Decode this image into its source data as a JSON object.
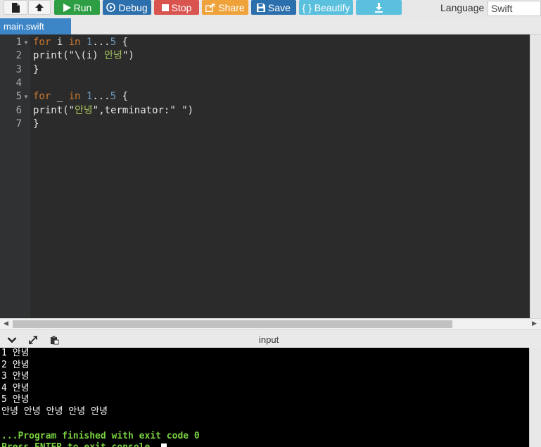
{
  "toolbar": {
    "new_file_icon": "file-icon",
    "upload_icon": "upload-icon",
    "run": {
      "label": "Run",
      "color": "#2e9e44"
    },
    "debug": {
      "label": "Debug",
      "color": "#2c6fad"
    },
    "stop": {
      "label": "Stop",
      "color": "#d9534f"
    },
    "share": {
      "label": "Share",
      "color": "#f0a23a"
    },
    "save": {
      "label": "Save",
      "color": "#2c6fad"
    },
    "beautify": {
      "label": "{ } Beautify",
      "color": "#5bc0de"
    },
    "download": {
      "icon": "download-icon",
      "color": "#5bc0de"
    },
    "language_label": "Language",
    "language_value": "Swift"
  },
  "tab": {
    "label": "main.swift"
  },
  "editor": {
    "line_numbers": [
      "1",
      "2",
      "3",
      "4",
      "5",
      "6",
      "7"
    ],
    "lines": [
      {
        "parts": [
          [
            "kw",
            "for"
          ],
          [
            "",
            " i "
          ],
          [
            "kw",
            "in"
          ],
          [
            "",
            " "
          ],
          [
            "num",
            "1"
          ],
          [
            "",
            "..."
          ],
          [
            "num",
            "5"
          ],
          [
            "",
            " {"
          ]
        ]
      },
      {
        "parts": [
          [
            "",
            "print(\""
          ],
          [
            "",
            "\\(i) "
          ],
          [
            "str",
            "안녕"
          ],
          [
            "",
            "\")"
          ]
        ]
      },
      {
        "parts": [
          [
            "",
            "}"
          ]
        ]
      },
      {
        "parts": []
      },
      {
        "parts": [
          [
            "kw",
            "for"
          ],
          [
            "",
            " _ "
          ],
          [
            "kw",
            "in"
          ],
          [
            "",
            " "
          ],
          [
            "num",
            "1"
          ],
          [
            "",
            "..."
          ],
          [
            "num",
            "5"
          ],
          [
            "",
            " {"
          ]
        ]
      },
      {
        "parts": [
          [
            "",
            "print(\""
          ],
          [
            "str",
            "안녕"
          ],
          [
            "",
            "\",terminator:\" \")"
          ]
        ]
      },
      {
        "parts": [
          [
            "",
            "}"
          ]
        ]
      }
    ]
  },
  "io": {
    "input_label": "input",
    "icons": [
      "chevron-down-icon",
      "expand-icon",
      "paste-icon"
    ]
  },
  "console": {
    "lines": [
      "1 안녕",
      "2 안녕",
      "3 안녕",
      "4 안녕",
      "5 안녕",
      "안녕 안녕 안녕 안녕 안녕",
      "",
      "...Program finished with exit code 0",
      "Press ENTER to exit console."
    ]
  }
}
